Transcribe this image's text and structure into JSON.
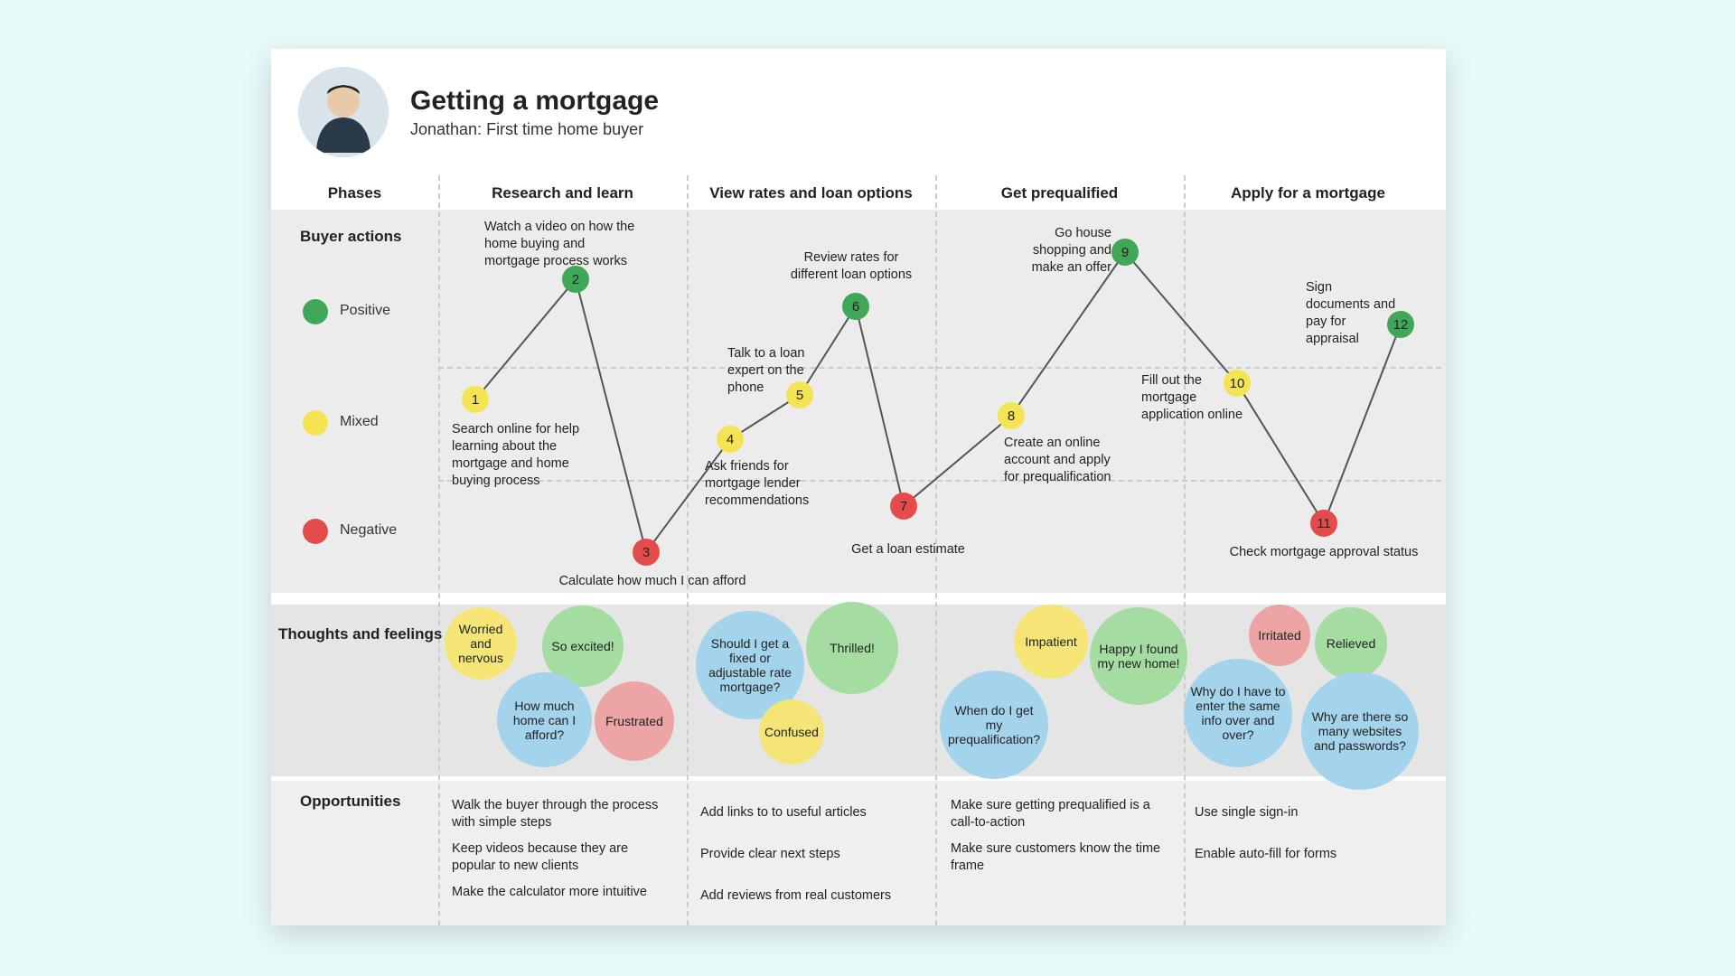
{
  "header": {
    "title": "Getting a mortgage",
    "subtitle": "Jonathan: First time home buyer"
  },
  "columns": {
    "phases": "Phases",
    "research": "Research and learn",
    "rates": "View rates and loan options",
    "prequal": "Get prequalified",
    "apply": "Apply for a mortgage"
  },
  "rows": {
    "buyer_actions": "Buyer actions",
    "thoughts": "Thoughts and feelings",
    "opportunities": "Opportunities"
  },
  "legend": {
    "positive": "Positive",
    "mixed": "Mixed",
    "negative": "Negative"
  },
  "nodes": {
    "n1": {
      "num": "1",
      "label": "Search online for help learning about the mortgage and home buying process"
    },
    "n2": {
      "num": "2",
      "label": "Watch a video on how the home buying and mortgage process works"
    },
    "n3": {
      "num": "3",
      "label": "Calculate how much I can afford"
    },
    "n4": {
      "num": "4",
      "label": "Ask friends for mortgage lender recommendations"
    },
    "n5": {
      "num": "5",
      "label": "Talk to a loan expert on the phone"
    },
    "n6": {
      "num": "6",
      "label": "Review rates for different loan options"
    },
    "n7": {
      "num": "7",
      "label": "Get a loan estimate"
    },
    "n8": {
      "num": "8",
      "label": "Create an online account and apply for prequalification"
    },
    "n9": {
      "num": "9",
      "label": "Go house shopping and make an offer"
    },
    "n10": {
      "num": "10",
      "label": "Fill out the mortgage application online"
    },
    "n11": {
      "num": "11",
      "label": "Check mortgage approval status"
    },
    "n12": {
      "num": "12",
      "label": "Sign documents and pay for appraisal"
    }
  },
  "thoughts": {
    "t1": "Worried and nervous",
    "t2": "So excited!",
    "t3": "How much home can I afford?",
    "t4": "Frustrated",
    "t5": "Should I get a fixed or adjustable rate mortgage?",
    "t6": "Thrilled!",
    "t7": "Confused",
    "t8": "When do I get my prequalification?",
    "t9": "Impatient",
    "t10": "Happy I found my new home!",
    "t11": "Why do I have to enter the same info over and over?",
    "t12": "Irritated",
    "t13": "Relieved",
    "t14": "Why are there so many websites and passwords?"
  },
  "opps": {
    "research": [
      "Walk the buyer through the process with simple steps",
      "Keep videos because they are popular to new clients",
      "Make the calculator more intuitive"
    ],
    "rates": [
      "Add links to to useful articles",
      "Provide clear next steps",
      "Add reviews from real customers"
    ],
    "prequal": [
      "Make sure getting prequalified is a call-to-action",
      "Make sure customers know the time frame"
    ],
    "apply": [
      "Use single sign-in",
      "Enable auto-fill for forms"
    ]
  },
  "colors": {
    "positive": "#3fa757",
    "mixed": "#f4e454",
    "negative": "#e44b4b",
    "bubble_blue": "#a4d4ec",
    "bubble_green": "#a4dca1",
    "bubble_yellow": "#f4e576",
    "bubble_red": "#eca4a4"
  },
  "chart_data": {
    "type": "line",
    "title": "Customer journey emotional scoring",
    "y_levels": [
      "Positive",
      "Mixed",
      "Negative"
    ],
    "phases": [
      "Research and learn",
      "View rates and loan options",
      "Get prequalified",
      "Apply for a mortgage"
    ],
    "points": [
      {
        "step": 1,
        "phase": "Research and learn",
        "sentiment": "Mixed",
        "action": "Search online for help learning about the mortgage and home buying process"
      },
      {
        "step": 2,
        "phase": "Research and learn",
        "sentiment": "Positive",
        "action": "Watch a video on how the home buying and mortgage process works"
      },
      {
        "step": 3,
        "phase": "Research and learn",
        "sentiment": "Negative",
        "action": "Calculate how much I can afford"
      },
      {
        "step": 4,
        "phase": "View rates and loan options",
        "sentiment": "Mixed",
        "action": "Ask friends for mortgage lender recommendations"
      },
      {
        "step": 5,
        "phase": "View rates and loan options",
        "sentiment": "Mixed",
        "action": "Talk to a loan expert on the phone"
      },
      {
        "step": 6,
        "phase": "View rates and loan options",
        "sentiment": "Positive",
        "action": "Review rates for different loan options"
      },
      {
        "step": 7,
        "phase": "View rates and loan options",
        "sentiment": "Negative",
        "action": "Get a loan estimate"
      },
      {
        "step": 8,
        "phase": "Get prequalified",
        "sentiment": "Mixed",
        "action": "Create an online account and apply for prequalification"
      },
      {
        "step": 9,
        "phase": "Get prequalified",
        "sentiment": "Positive",
        "action": "Go house shopping and make an offer"
      },
      {
        "step": 10,
        "phase": "Apply for a mortgage",
        "sentiment": "Mixed",
        "action": "Fill out the mortgage application online"
      },
      {
        "step": 11,
        "phase": "Apply for a mortgage",
        "sentiment": "Negative",
        "action": "Check mortgage approval status"
      },
      {
        "step": 12,
        "phase": "Apply for a mortgage",
        "sentiment": "Positive",
        "action": "Sign documents and pay for appraisal"
      }
    ]
  }
}
